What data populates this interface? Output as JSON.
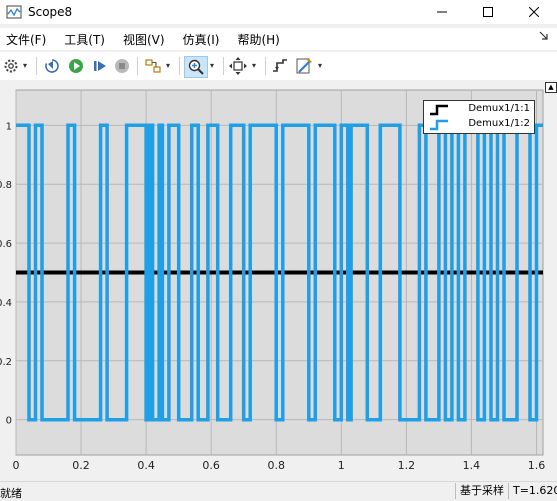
{
  "window": {
    "title": "Scope8",
    "controls": [
      "minimize",
      "maximize",
      "close"
    ]
  },
  "menu": {
    "items": [
      "文件(F)",
      "工具(T)",
      "视图(V)",
      "仿真(I)",
      "帮助(H)"
    ]
  },
  "toolbar": {
    "buttons": [
      {
        "name": "settings-icon"
      },
      {
        "name": "step-back-icon"
      },
      {
        "name": "run-icon"
      },
      {
        "name": "step-forward-icon"
      },
      {
        "name": "stop-icon"
      },
      {
        "name": "signal-select-icon"
      },
      {
        "name": "zoom-in-icon"
      },
      {
        "name": "fit-to-view-icon"
      },
      {
        "name": "trigger-icon"
      },
      {
        "name": "style-icon"
      }
    ]
  },
  "chart_data": {
    "type": "line",
    "xlim": [
      0,
      1.62
    ],
    "ylim": [
      -0.12,
      1.12
    ],
    "xticks": [
      0,
      0.2,
      0.4,
      0.6,
      0.8,
      1,
      1.2,
      1.4,
      1.6
    ],
    "yticks": [
      0,
      0.2,
      0.4,
      0.6,
      0.8,
      1
    ],
    "grid": true,
    "legend_position": "top-right",
    "series": [
      {
        "name": "Demux1/1:1",
        "color": "#000000",
        "x": [
          0,
          1.62
        ],
        "y": [
          0.5,
          0.5
        ]
      },
      {
        "name": "Demux1/1:2",
        "color": "#1f9fe6",
        "x": [
          0,
          0.04,
          0.04,
          0.06,
          0.06,
          0.08,
          0.08,
          0.16,
          0.16,
          0.18,
          0.18,
          0.26,
          0.26,
          0.28,
          0.28,
          0.34,
          0.34,
          0.4,
          0.4,
          0.41,
          0.41,
          0.42,
          0.42,
          0.44,
          0.44,
          0.45,
          0.45,
          0.47,
          0.47,
          0.5,
          0.5,
          0.54,
          0.54,
          0.56,
          0.56,
          0.59,
          0.59,
          0.62,
          0.62,
          0.66,
          0.66,
          0.7,
          0.7,
          0.72,
          0.72,
          0.8,
          0.8,
          0.82,
          0.82,
          0.9,
          0.9,
          0.92,
          0.92,
          0.98,
          0.98,
          1.0,
          1.0,
          1.02,
          1.02,
          1.03,
          1.03,
          1.08,
          1.08,
          1.12,
          1.12,
          1.18,
          1.18,
          1.24,
          1.24,
          1.26,
          1.26,
          1.3,
          1.3,
          1.32,
          1.32,
          1.34,
          1.34,
          1.36,
          1.36,
          1.38,
          1.38,
          1.42,
          1.42,
          1.44,
          1.44,
          1.46,
          1.46,
          1.48,
          1.48,
          1.5,
          1.5,
          1.54,
          1.54,
          1.58,
          1.58,
          1.6,
          1.6,
          1.62
        ],
        "y": [
          1,
          1,
          0,
          0,
          1,
          1,
          0,
          0,
          1,
          1,
          0,
          0,
          1,
          1,
          0,
          0,
          1,
          1,
          0,
          0,
          1,
          1,
          0,
          0,
          1,
          1,
          0,
          0,
          1,
          1,
          0,
          0,
          1,
          1,
          0,
          0,
          1,
          1,
          0,
          0,
          1,
          1,
          0,
          0,
          1,
          1,
          0,
          0,
          1,
          1,
          0,
          0,
          1,
          1,
          0,
          0,
          1,
          1,
          0,
          0,
          1,
          1,
          0,
          0,
          1,
          1,
          0,
          0,
          1,
          1,
          0,
          0,
          1,
          1,
          0,
          0,
          1,
          1,
          0,
          0,
          1,
          1,
          0,
          0,
          1,
          1,
          0,
          0,
          1,
          1,
          0,
          0,
          1,
          1,
          0,
          0,
          1,
          1
        ]
      }
    ]
  },
  "status": {
    "left_text": "就绪",
    "mode": "基于采样",
    "time": "T=1.620"
  }
}
